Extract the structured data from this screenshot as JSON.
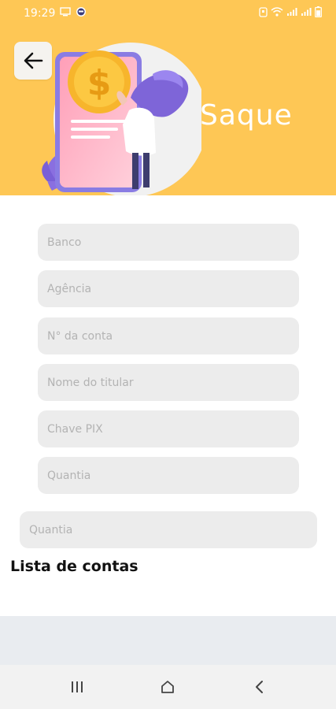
{
  "status_bar": {
    "time": "19:29",
    "battery_level": 0.7
  },
  "header": {
    "title": "Saque",
    "background_color": "#fec755"
  },
  "form": {
    "fields": [
      {
        "name": "banco",
        "placeholder": "Banco",
        "value": ""
      },
      {
        "name": "agencia",
        "placeholder": "Agência",
        "value": ""
      },
      {
        "name": "numero-conta",
        "placeholder": "N° da conta",
        "value": ""
      },
      {
        "name": "nome-titular",
        "placeholder": "Nome do titular",
        "value": ""
      },
      {
        "name": "chave-pix",
        "placeholder": "Chave PIX",
        "value": ""
      },
      {
        "name": "quantia",
        "placeholder": "Quantia",
        "value": ""
      }
    ],
    "amount_field": {
      "placeholder": "Quantia",
      "value": ""
    }
  },
  "accounts": {
    "title": "Lista de contas"
  },
  "icons": {
    "back": "arrow-left-icon",
    "recent_apps": "recent-apps-icon",
    "home": "home-icon",
    "nav_back": "chevron-left-icon"
  }
}
